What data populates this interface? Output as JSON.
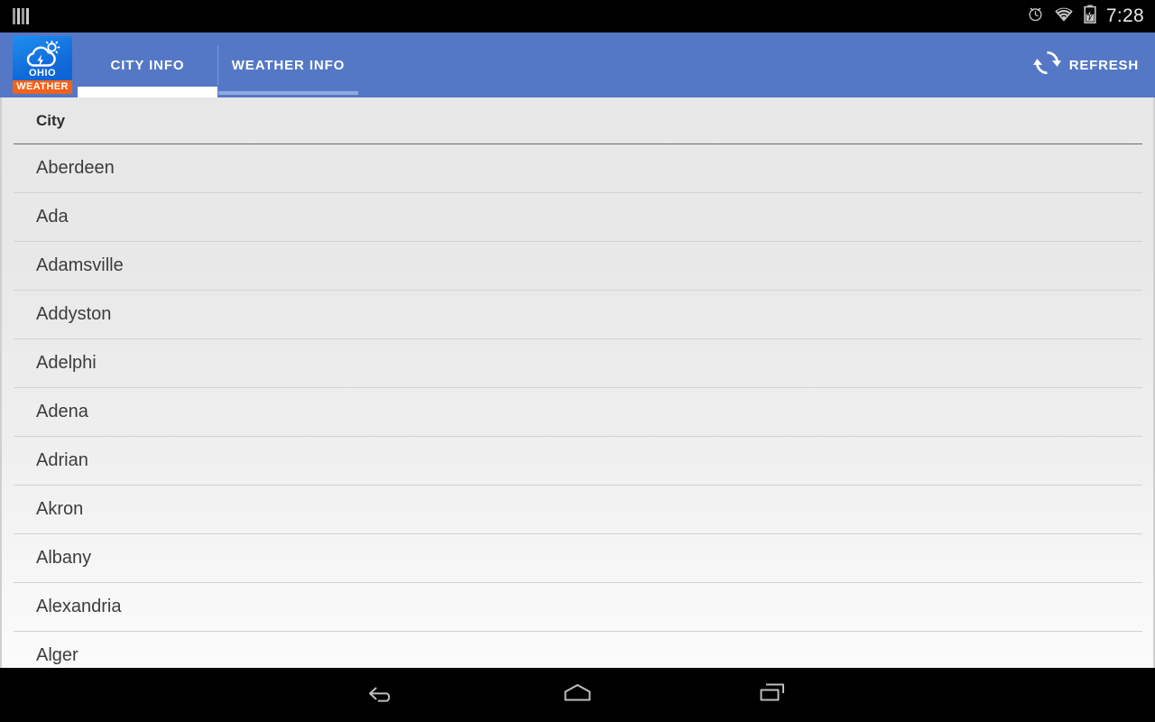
{
  "status_bar": {
    "notification_icon": "notification-bars-icon",
    "alarm_icon": "alarm-clock-icon",
    "wifi_icon": "wifi-icon",
    "battery_icon": "battery-charging-icon",
    "time": "7:28"
  },
  "action_bar": {
    "app_icon": {
      "name": "ohio-weather-app-icon",
      "glyph": "cloud-lightning-sun-icon",
      "line1": "OHIO",
      "line2": "WEATHER",
      "bg_color": "#1169d8",
      "banner_color": "#f2621a"
    },
    "bg_color": "#5578c6",
    "tabs": [
      {
        "label": "CITY INFO",
        "active": true
      },
      {
        "label": "WEATHER INFO",
        "active": false
      }
    ],
    "refresh": {
      "label": "REFRESH",
      "icon": "refresh-icon"
    }
  },
  "main": {
    "column_header": "City",
    "rows": [
      {
        "city": "Aberdeen"
      },
      {
        "city": "Ada"
      },
      {
        "city": "Adamsville"
      },
      {
        "city": "Addyston"
      },
      {
        "city": "Adelphi"
      },
      {
        "city": "Adena"
      },
      {
        "city": "Adrian"
      },
      {
        "city": "Akron"
      },
      {
        "city": "Albany"
      },
      {
        "city": "Alexandria"
      },
      {
        "city": "Alger"
      }
    ]
  },
  "nav_bar": {
    "back": "back-icon",
    "home": "home-icon",
    "recents": "recent-apps-icon"
  }
}
